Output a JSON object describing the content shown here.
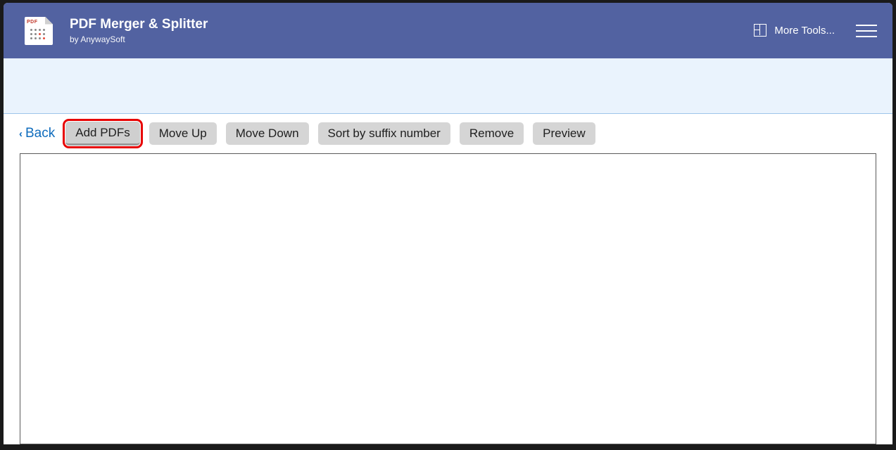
{
  "header": {
    "app_title": "PDF Merger & Splitter",
    "app_subtitle": "by AnywaySoft",
    "more_tools_label": "More Tools..."
  },
  "toolbar": {
    "back_label": "Back",
    "buttons": {
      "add": "Add PDFs",
      "move_up": "Move Up",
      "move_down": "Move Down",
      "sort_suffix": "Sort by suffix number",
      "remove": "Remove",
      "preview": "Preview"
    }
  }
}
